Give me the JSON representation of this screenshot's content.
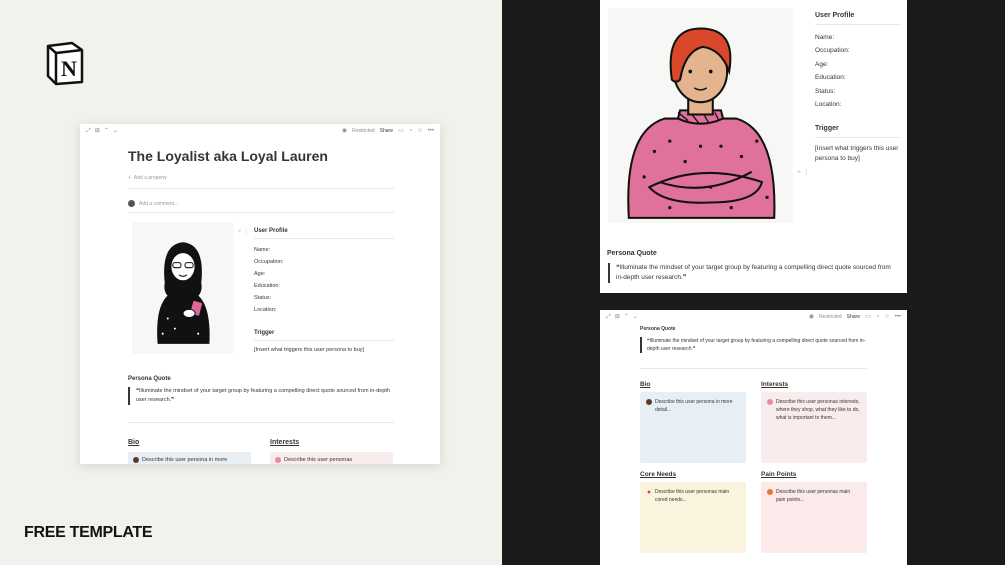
{
  "brand": {
    "logo_letter": "N",
    "tagline": "FREE TEMPLATE"
  },
  "colors": {
    "left_bg": "#f2f1ec",
    "right_bg": "#1b1b1b",
    "bio_card": "#e7eff5",
    "interests_card": "#f9ecec",
    "core_needs_card": "#faf3dd",
    "pain_points_card": "#fbeaea"
  },
  "left_window": {
    "topbar": {
      "restricted": "Restricted",
      "share": "Share"
    },
    "title": "The Loyalist aka Loyal Lauren",
    "add_property": "Add a property",
    "add_comment": "Add a comment...",
    "profile": {
      "heading": "User Profile",
      "fields": [
        "Name:",
        "Occupation:",
        "Age:",
        "Education:",
        "Status:",
        "Location:"
      ]
    },
    "trigger": {
      "heading": "Trigger",
      "text": "[Insert what triggers this user persona to buy]"
    },
    "persona_quote": {
      "heading": "Persona Quote",
      "text": "❝Illuminate the mindset of your target group by featuring a compelling direct quote sourced from in-depth user research.❞"
    },
    "bio": {
      "heading": "Bio",
      "text": "Describe this user persona in more"
    },
    "interests": {
      "heading": "Interests",
      "text": "Describe this user personas"
    }
  },
  "top_right_window": {
    "profile": {
      "heading": "User Profile",
      "fields": [
        "Name:",
        "Occupation:",
        "Age:",
        "Education:",
        "Status:",
        "Location:"
      ]
    },
    "trigger": {
      "heading": "Trigger",
      "text": "[Insert what triggers this user persona to buy]"
    },
    "persona_quote": {
      "heading": "Persona Quote",
      "text": "❝Illuminate the mindset of your target group by featuring a compelling direct quote sourced from in-depth user research.❞"
    }
  },
  "bottom_right_window": {
    "topbar": {
      "restricted": "Restricted",
      "share": "Share"
    },
    "persona_quote": {
      "heading": "Persona Quote",
      "text": "❝Illuminate the mindset of your target group by featuring a compelling direct quote sourced from in-depth user research.❞"
    },
    "bio": {
      "heading": "Bio",
      "text": "Describe this user persona in more detail..."
    },
    "interests": {
      "heading": "Interests",
      "text": "Describe this user personas interests, where they shop, what they like to do, what is important to them..."
    },
    "core_needs": {
      "heading": "Core Needs",
      "text": "Describe this user personas main cored needs..."
    },
    "pain_points": {
      "heading": "Pain Points",
      "text": "Describe this user personas main pain points..."
    }
  }
}
